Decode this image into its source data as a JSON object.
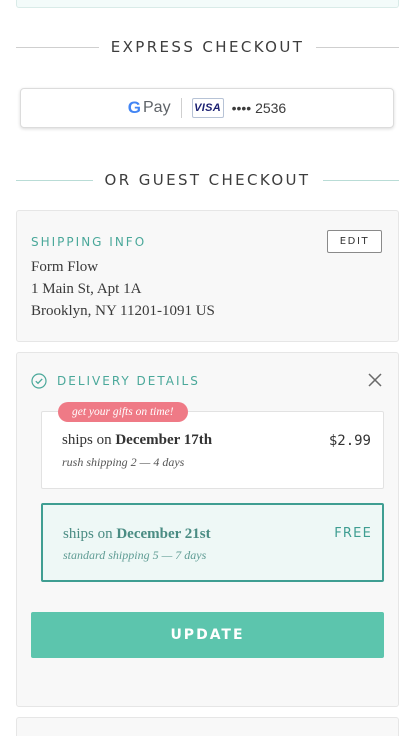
{
  "express_checkout": {
    "heading": "EXPRESS CHECKOUT",
    "gpay": {
      "g_letter": "G",
      "pay_label": "Pay",
      "card_brand": "VISA",
      "card_number": "•••• 2536"
    }
  },
  "guest_checkout": {
    "heading": "OR GUEST CHECKOUT"
  },
  "shipping_info": {
    "label": "SHIPPING INFO",
    "edit_label": "EDIT",
    "address_lines": [
      "Form Flow",
      "1 Main St, Apt 1A",
      "Brooklyn, NY 11201-1091 US"
    ]
  },
  "delivery_details": {
    "label": "DELIVERY DETAILS",
    "options": [
      {
        "badge": "get your gifts on time!",
        "ships_prefix": "ships on ",
        "ships_date": "December 17th",
        "method": "rush shipping 2 — 4 days",
        "price": "$2.99",
        "selected": false
      },
      {
        "badge": "",
        "ships_prefix": "ships on ",
        "ships_date": "December 21st",
        "method": "standard shipping 5 — 7 days",
        "price": "FREE",
        "selected": true
      }
    ],
    "update_label": "UPDATE"
  },
  "colors": {
    "accent_teal": "#4aa89a",
    "button_green": "#5cc5ad",
    "badge_pink": "#ef7a86",
    "selected_border": "#3f9e92"
  }
}
